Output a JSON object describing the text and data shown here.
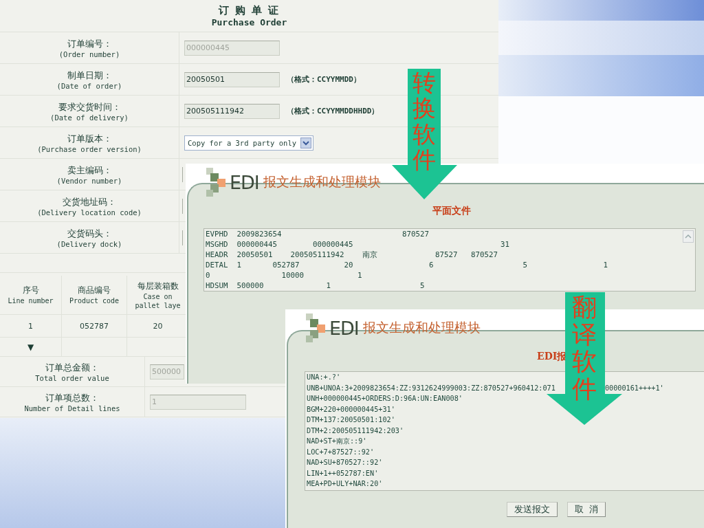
{
  "order_form": {
    "title": "订 购 单 证",
    "subtitle": "Purchase Order",
    "fields": [
      {
        "label": "订单编号：",
        "label_en": "(Order number)",
        "kind": "input",
        "value": "000000445",
        "disabled": true
      },
      {
        "label": "制单日期：",
        "label_en": "(Date of order)",
        "kind": "input",
        "value": "20050501",
        "disabled": false,
        "hint": "（格式：CCYYMMDD）"
      },
      {
        "label": "要求交货时间：",
        "label_en": "(Date of delivery)",
        "kind": "input",
        "value": "200505111942",
        "disabled": false,
        "hint": "（格式：CCYYMMDDHHDD）"
      },
      {
        "label": "订单版本：",
        "label_en": "(Purchase order version)",
        "kind": "select",
        "value": "Copy for a 3rd party only"
      },
      {
        "label": "卖主编码：",
        "label_en": "(Vendor number)",
        "kind": "covered"
      },
      {
        "label": "交货地址码：",
        "label_en": "(Delivery location code)",
        "kind": "covered"
      },
      {
        "label": "交货码头：",
        "label_en": "(Delivery dock)",
        "kind": "covered"
      }
    ],
    "table": {
      "columns": [
        {
          "label": "序号",
          "label_en": "Line number"
        },
        {
          "label": "商品编号",
          "label_en": "Product code"
        },
        {
          "label": "每层装箱数",
          "label_en": "Case on pallet laye"
        }
      ],
      "rows": [
        [
          "1",
          "052787",
          "20"
        ]
      ],
      "expand_marker": "▼"
    },
    "totals": [
      {
        "label": "订单总金额：",
        "label_en": "Total order value",
        "value": "500000"
      },
      {
        "label": "订单项总数：",
        "label_en": "Number of Detail lines",
        "value": "1"
      }
    ]
  },
  "flat_file_window": {
    "logo": "EDI",
    "module_title": "报文生成和处理模块",
    "heading": "平面文件",
    "lines": [
      "EVPHD  2009823654                           870527",
      "MSGHD  000000445        000000445                                 31",
      "HEADR  20050501    200505111942    南京             87527   870527",
      "DETAL  1       052787          20                 6                    5                 1",
      "0                10000            1",
      "HDSUM  500000              1                    5"
    ]
  },
  "edi_window": {
    "logo": "EDI",
    "module_title": "报文生成和处理模块",
    "heading": "EDI报",
    "lines": [
      [
        "UNA:+.?'"
      ],
      [
        "UNB+UNOA:3+2009823654:ZZ:9312624999003:ZZ:870527+960412:071",
        "00000161++++1'"
      ],
      [
        "UNH+000000445+ORDERS:D:96A:UN:EAN008'"
      ],
      [
        "BGM+220+000000445+31'"
      ],
      [
        "DTM+137:20050501:102'"
      ],
      [
        "DTM+2:200505111942:203'"
      ],
      [
        "NAD+ST+南京::9'"
      ],
      [
        "LOC+7+87527::92'"
      ],
      [
        "NAD+SU+870527::92'"
      ],
      [
        "LIN+1++052787:EN'"
      ],
      [
        "MEA+PD+ULY+NAR:20'"
      ]
    ],
    "buttons": [
      "发送报文",
      "取  消"
    ]
  },
  "arrows": [
    {
      "label": "转换软件"
    },
    {
      "label": "翻译软件"
    }
  ]
}
